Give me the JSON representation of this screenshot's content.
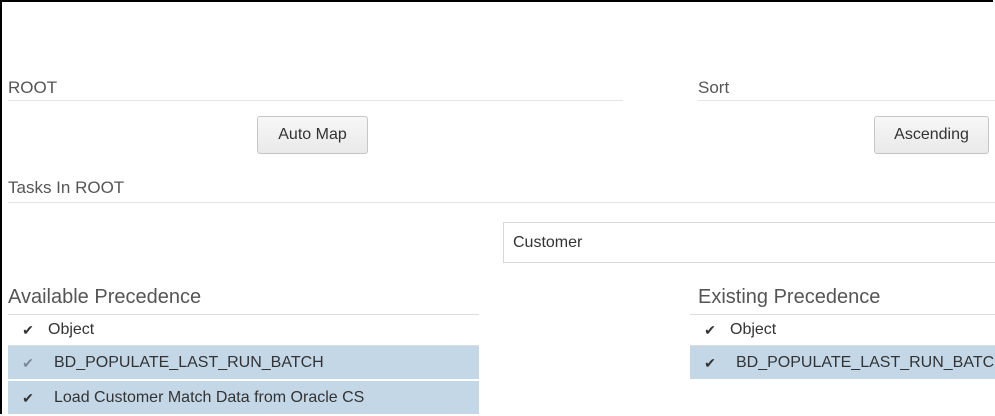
{
  "root_section": {
    "label": "ROOT",
    "auto_map_label": "Auto Map"
  },
  "sort_section": {
    "label": "Sort",
    "ascending_label": "Ascending"
  },
  "tasks_section": {
    "label": "Tasks In ROOT"
  },
  "search": {
    "value": "Customer"
  },
  "available_precedence": {
    "title": "Available Precedence",
    "header": {
      "column": "Object",
      "check": "✔"
    },
    "rows": [
      {
        "check": "✔",
        "label": "BD_POPULATE_LAST_RUN_BATCH"
      },
      {
        "check": "✔",
        "label": "Load Customer Match Data from Oracle CS"
      }
    ]
  },
  "existing_precedence": {
    "title": "Existing Precedence",
    "header": {
      "column": "Object",
      "check": "✔"
    },
    "rows": [
      {
        "check": "✔",
        "label": "BD_POPULATE_LAST_RUN_BATCH"
      }
    ]
  },
  "colors": {
    "selected_row": "#c3d7e7",
    "button_bg": "#efefef",
    "rule": "#e4e4e4"
  }
}
